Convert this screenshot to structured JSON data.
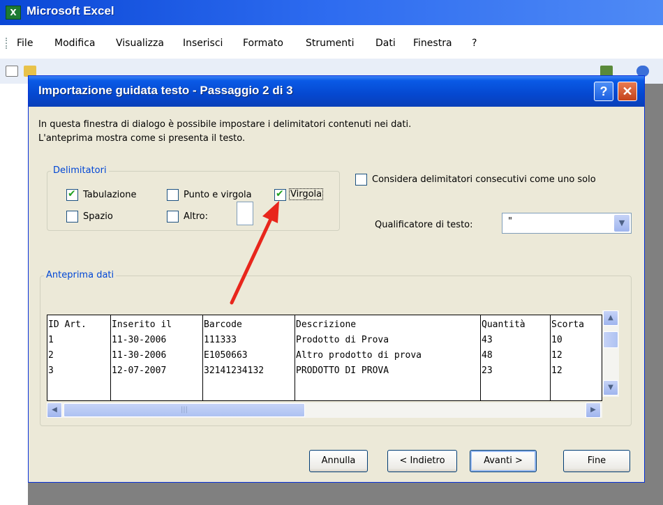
{
  "app": {
    "title": "Microsoft Excel",
    "icon": "excel-icon"
  },
  "menubar": {
    "items": [
      "File",
      "Modifica",
      "Visualizza",
      "Inserisci",
      "Formato",
      "Strumenti",
      "Dati",
      "Finestra",
      "?"
    ]
  },
  "dialog": {
    "title": "Importazione guidata testo - Passaggio 2 di 3",
    "help_label": "?",
    "close_label": "✕",
    "intro_line1": "In questa finestra di dialogo è possibile impostare i delimitatori contenuti nei dati.",
    "intro_line2": "L'anteprima mostra come si presenta il testo.",
    "delimiters": {
      "group_label": "Delimitatori",
      "tab": {
        "label": "Tabulazione",
        "checked": true
      },
      "semicolon": {
        "label": "Punto e virgola",
        "checked": false
      },
      "comma": {
        "label": "Virgola",
        "checked": true
      },
      "space": {
        "label": "Spazio",
        "checked": false
      },
      "other": {
        "label": "Altro:",
        "checked": false,
        "value": ""
      }
    },
    "consecutive": {
      "label": "Considera delimitatori consecutivi come uno solo",
      "checked": false
    },
    "qualifier": {
      "label": "Qualificatore di testo:",
      "value": "\""
    },
    "preview": {
      "group_label": "Anteprima dati",
      "columns": [
        {
          "header": "ID Art.",
          "cells": [
            "1",
            "2",
            "3"
          ]
        },
        {
          "header": "Inserito il",
          "cells": [
            "11-30-2006",
            "11-30-2006",
            "12-07-2007"
          ]
        },
        {
          "header": "Barcode",
          "cells": [
            "111333",
            "E1050663",
            "32141234132"
          ]
        },
        {
          "header": "Descrizione",
          "cells": [
            "Prodotto di Prova",
            "Altro prodotto di prova",
            "PRODOTTO DI PROVA"
          ]
        },
        {
          "header": "Quantità",
          "cells": [
            "43",
            "48",
            "23"
          ]
        },
        {
          "header": "Scorta",
          "cells": [
            "10",
            "12",
            "12"
          ]
        }
      ]
    },
    "buttons": {
      "cancel": "Annulla",
      "back": "< Indietro",
      "next": "Avanti >",
      "finish": "Fine"
    }
  },
  "annotation": {
    "arrow_color": "#e8261c"
  },
  "colors": {
    "dialog_bg": "#ece9d8",
    "titlebar": "#0548d0",
    "group_label": "#0046d5"
  }
}
